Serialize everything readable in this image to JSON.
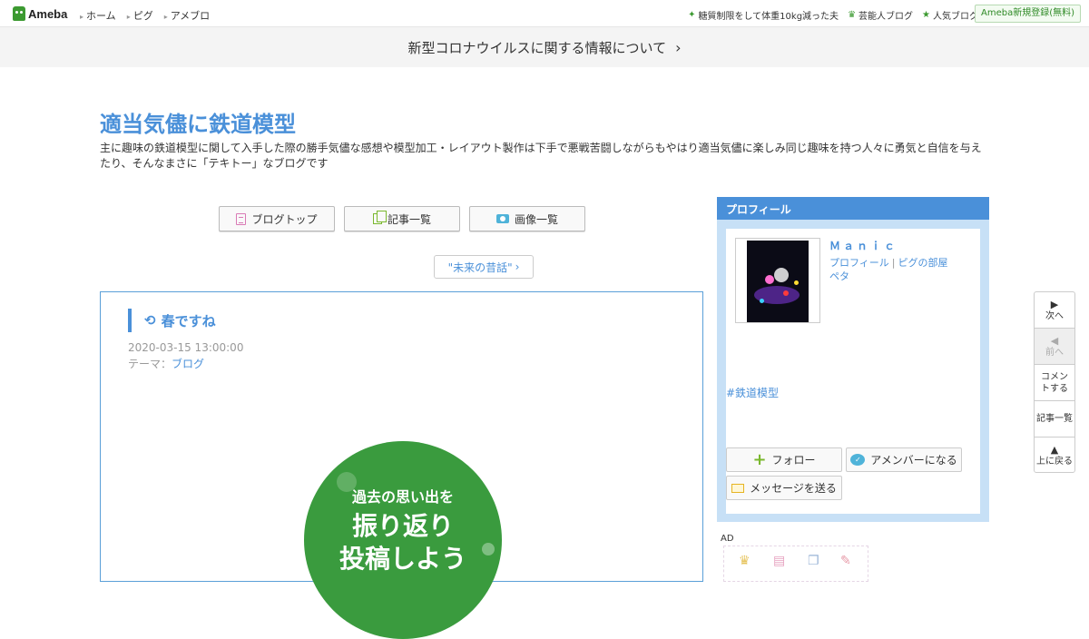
{
  "header": {
    "logo": "Ameba",
    "nav": [
      "ホーム",
      "ピグ",
      "アメブロ"
    ],
    "right_links": [
      {
        "icon": "sparkle-icon",
        "label": "糖質制限をして体重10kg減った夫"
      },
      {
        "icon": "crown-icon",
        "label": "芸能人ブログ"
      },
      {
        "icon": "star-icon",
        "label": "人気ブログ"
      }
    ],
    "signup": "Ameba新規登録(無料)"
  },
  "notice": {
    "text": "新型コロナウイルスに関する情報について",
    "chevron": "›"
  },
  "blog": {
    "title": "適当気儘に鉄道模型",
    "description": "主に趣味の鉄道模型に関して入手した際の勝手気儘な感想や模型加工・レイアウト製作は下手で悪戦苦闘しながらもやはり適当気儘に楽しみ同じ趣味を持つ人々に勇気と自信を与えたり、そんなまさに「テキトー」なブログです"
  },
  "buttons": {
    "top": "ブログトップ",
    "list": "記事一覧",
    "images": "画像一覧"
  },
  "nav_pill": "\"未来の昔話\"",
  "entry": {
    "title": "春ですね",
    "date": "2020-03-15 13:00:00",
    "theme_label": "テーマ：",
    "theme": "ブログ",
    "image_text": [
      "過去の思い出を",
      "振り返り",
      "投稿しよう"
    ]
  },
  "profile": {
    "header": "プロフィール",
    "name": "Ｍａｎｉｃ",
    "links": [
      "プロフィール",
      "ピグの部屋"
    ],
    "link_separator": "|",
    "peta": "ペタ",
    "hashtag": "#鉄道模型",
    "follow": "フォロー",
    "amember": "アメンバーになる",
    "message": "メッセージを送る"
  },
  "ad_label": "AD",
  "side_nav": [
    {
      "arrow": "▶",
      "label": "次へ",
      "disabled": false
    },
    {
      "arrow": "◀",
      "label": "前へ",
      "disabled": true
    },
    {
      "arrow": "",
      "label": "コメントする",
      "disabled": false
    },
    {
      "arrow": "",
      "label": "記事一覧",
      "disabled": false
    },
    {
      "arrow": "▲",
      "label": "上に戻る",
      "disabled": false
    }
  ],
  "colors": {
    "accent": "#4a90d9",
    "brand_green": "#3c9a31",
    "profile_bg": "#c7e0f6"
  }
}
